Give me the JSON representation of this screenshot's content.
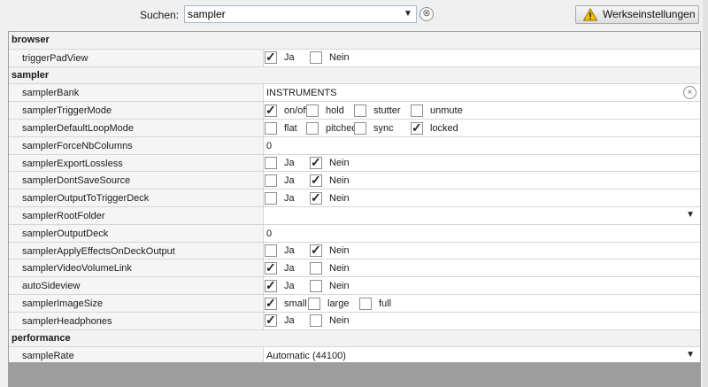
{
  "toolbar": {
    "search_label": "Suchen:",
    "search_value": "sampler",
    "clear_glyph": "⊗",
    "reset_label": "Werkseinstellungen"
  },
  "icons": {
    "warning": "warning-icon",
    "dropdown": "chevron-down-icon",
    "clear": "clear-circle-icon",
    "check": "checkmark-icon"
  },
  "colors": {
    "warning_fill": "#f5c400",
    "section_bg": "#f2f2f2",
    "footer_bar": "#9d9d9d"
  },
  "rows": [
    {
      "type": "section",
      "label": "browser"
    },
    {
      "type": "setting",
      "name": "triggerPadView",
      "kind": "checks",
      "options": [
        {
          "label": "Ja",
          "checked": true
        },
        {
          "label": "Nein",
          "checked": false
        }
      ]
    },
    {
      "type": "section",
      "label": "sampler"
    },
    {
      "type": "setting",
      "name": "samplerBank",
      "kind": "text",
      "value": "INSTRUMENTS",
      "clearable": true
    },
    {
      "type": "setting",
      "name": "samplerTriggerMode",
      "kind": "checks",
      "options": [
        {
          "label": "on/off",
          "checked": true
        },
        {
          "label": "hold",
          "checked": false
        },
        {
          "label": "stutter",
          "checked": false
        },
        {
          "label": "unmute",
          "checked": false
        }
      ]
    },
    {
      "type": "setting",
      "name": "samplerDefaultLoopMode",
      "kind": "checks",
      "options": [
        {
          "label": "flat",
          "checked": false
        },
        {
          "label": "pitched",
          "checked": false
        },
        {
          "label": "sync",
          "checked": false
        },
        {
          "label": "locked",
          "checked": true
        }
      ]
    },
    {
      "type": "setting",
      "name": "samplerForceNbColumns",
      "kind": "text",
      "value": "0"
    },
    {
      "type": "setting",
      "name": "samplerExportLossless",
      "kind": "checks",
      "options": [
        {
          "label": "Ja",
          "checked": false
        },
        {
          "label": "Nein",
          "checked": true
        }
      ]
    },
    {
      "type": "setting",
      "name": "samplerDontSaveSource",
      "kind": "checks",
      "options": [
        {
          "label": "Ja",
          "checked": false
        },
        {
          "label": "Nein",
          "checked": true
        }
      ]
    },
    {
      "type": "setting",
      "name": "samplerOutputToTriggerDeck",
      "kind": "checks",
      "options": [
        {
          "label": "Ja",
          "checked": false
        },
        {
          "label": "Nein",
          "checked": true
        }
      ]
    },
    {
      "type": "setting",
      "name": "samplerRootFolder",
      "kind": "select",
      "value": ""
    },
    {
      "type": "setting",
      "name": "samplerOutputDeck",
      "kind": "text",
      "value": "0"
    },
    {
      "type": "setting",
      "name": "samplerApplyEffectsOnDeckOutput",
      "kind": "checks",
      "options": [
        {
          "label": "Ja",
          "checked": false
        },
        {
          "label": "Nein",
          "checked": true
        }
      ]
    },
    {
      "type": "setting",
      "name": "samplerVideoVolumeLink",
      "kind": "checks",
      "options": [
        {
          "label": "Ja",
          "checked": true
        },
        {
          "label": "Nein",
          "checked": false
        }
      ]
    },
    {
      "type": "setting",
      "name": "autoSideview",
      "kind": "checks",
      "options": [
        {
          "label": "Ja",
          "checked": true
        },
        {
          "label": "Nein",
          "checked": false
        }
      ]
    },
    {
      "type": "setting",
      "name": "samplerImageSize",
      "kind": "checks",
      "options": [
        {
          "label": "small",
          "checked": true
        },
        {
          "label": "large",
          "checked": false
        },
        {
          "label": "full",
          "checked": false
        }
      ]
    },
    {
      "type": "setting",
      "name": "samplerHeadphones",
      "kind": "checks",
      "options": [
        {
          "label": "Ja",
          "checked": true
        },
        {
          "label": "Nein",
          "checked": false
        }
      ]
    },
    {
      "type": "section",
      "label": "performance"
    },
    {
      "type": "setting",
      "name": "sampleRate",
      "kind": "select",
      "value": "Automatic (44100)"
    }
  ]
}
